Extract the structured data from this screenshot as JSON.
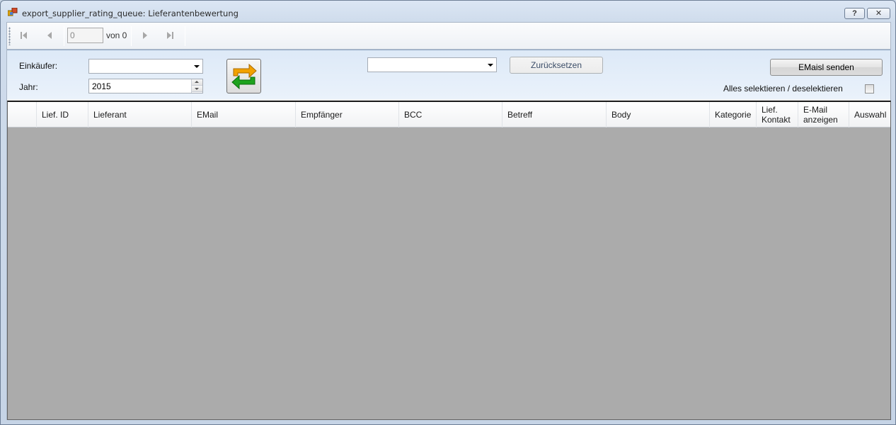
{
  "window": {
    "title": "export_supplier_rating_queue: Lieferantenbewertung",
    "help_label": "?",
    "close_label": "✕"
  },
  "navigator": {
    "position": "0",
    "count_label": "von 0"
  },
  "filters": {
    "buyer_label": "Einkäufer:",
    "buyer_value": "",
    "year_label": "Jahr:",
    "year_value": "2015",
    "template_value": "",
    "reset_label": "Zurücksetzen",
    "send_label": "EMaisl senden",
    "select_all_label": "Alles selektieren / deselektieren",
    "select_all_checked": false
  },
  "grid": {
    "columns": [
      "",
      "Lief. ID",
      "Lieferant",
      "EMail",
      "Empfänger",
      "BCC",
      "Betreff",
      "Body",
      "Kategorie",
      "Lief. Kontakt",
      "E-Mail anzeigen",
      "Auswahl"
    ],
    "rows": []
  },
  "colors": {
    "grid_background": "#ababab",
    "panel_background": "#dde9f7"
  }
}
